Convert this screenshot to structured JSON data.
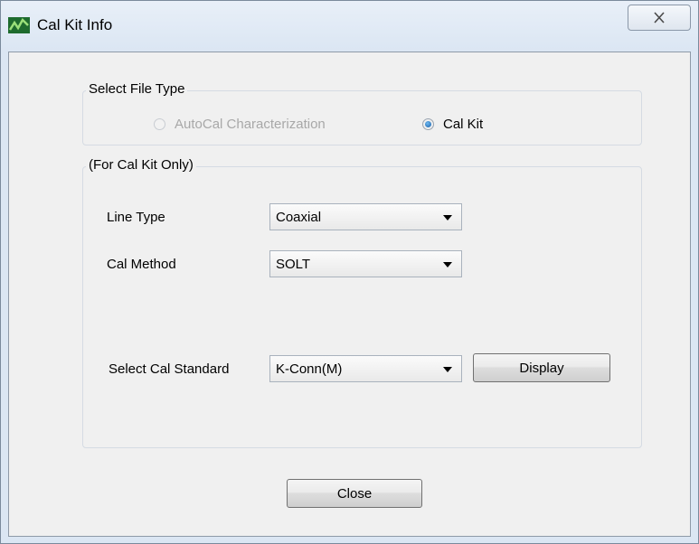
{
  "window": {
    "title": "Cal Kit Info",
    "close_icon": "x-close-icon"
  },
  "file_type_group": {
    "label": "Select File Type",
    "options": [
      {
        "label": "AutoCal Characterization",
        "selected": false,
        "enabled": false
      },
      {
        "label": "Cal Kit",
        "selected": true,
        "enabled": true
      }
    ]
  },
  "cal_kit_group": {
    "label": "(For Cal Kit Only)",
    "line_type": {
      "label": "Line Type",
      "value": "Coaxial"
    },
    "cal_method": {
      "label": "Cal Method",
      "value": "SOLT"
    },
    "cal_standard": {
      "label": "Select Cal Standard",
      "value": "K-Conn(M)"
    },
    "display_button": "Display"
  },
  "close_button": "Close",
  "colors": {
    "accent": "#1a5fa8",
    "disabled_text": "#a8a8a8"
  }
}
